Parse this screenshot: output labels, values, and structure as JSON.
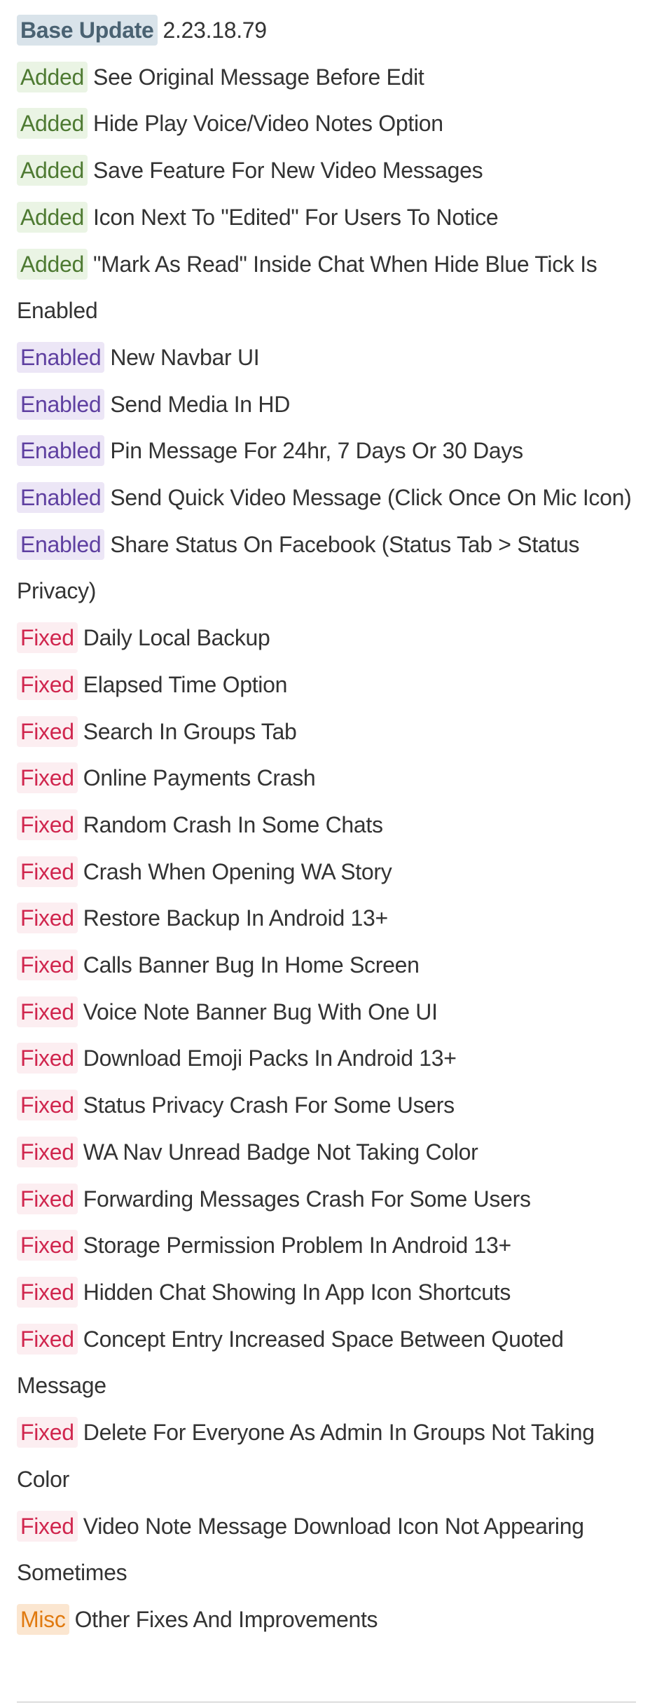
{
  "categories": {
    "base": {
      "label": "Base Update",
      "bg": "#d9e3ea",
      "fg": "#4a6272",
      "bold": true
    },
    "added": {
      "label": "Added",
      "bg": "#eaf4e4",
      "fg": "#4e7a32"
    },
    "enabled": {
      "label": "Enabled",
      "bg": "#ece6f6",
      "fg": "#5e3fa0"
    },
    "fixed": {
      "label": "Fixed",
      "bg": "#fceef1",
      "fg": "#d0264e"
    },
    "misc": {
      "label": "Misc",
      "bg": "#fbe6d0",
      "fg": "#e07a10"
    }
  },
  "items": [
    {
      "type": "base",
      "text": "2.23.18.79"
    },
    {
      "type": "added",
      "text": "See Original Message Before Edit"
    },
    {
      "type": "added",
      "text": "Hide Play Voice/Video Notes Option"
    },
    {
      "type": "added",
      "text": "Save Feature For New Video Messages"
    },
    {
      "type": "added",
      "text": "Icon Next To \"Edited\" For Users To Notice"
    },
    {
      "type": "added",
      "text": "\"Mark As Read\" Inside Chat When Hide Blue Tick Is Enabled"
    },
    {
      "type": "enabled",
      "text": "New Navbar UI"
    },
    {
      "type": "enabled",
      "text": "Send Media In HD"
    },
    {
      "type": "enabled",
      "text": "Pin Message For 24hr, 7 Days Or 30 Days"
    },
    {
      "type": "enabled",
      "text": "Send Quick Video Message (Click Once On Mic Icon)"
    },
    {
      "type": "enabled",
      "text": "Share Status On Facebook (Status Tab > Status Privacy)"
    },
    {
      "type": "fixed",
      "text": "Daily Local Backup"
    },
    {
      "type": "fixed",
      "text": "Elapsed Time Option"
    },
    {
      "type": "fixed",
      "text": "Search In Groups Tab"
    },
    {
      "type": "fixed",
      "text": "Online Payments Crash"
    },
    {
      "type": "fixed",
      "text": "Random Crash In Some Chats"
    },
    {
      "type": "fixed",
      "text": "Crash When Opening WA Story"
    },
    {
      "type": "fixed",
      "text": "Restore Backup In Android 13+"
    },
    {
      "type": "fixed",
      "text": "Calls Banner Bug In Home Screen"
    },
    {
      "type": "fixed",
      "text": "Voice Note Banner Bug With One UI"
    },
    {
      "type": "fixed",
      "text": "Download Emoji Packs In Android 13+"
    },
    {
      "type": "fixed",
      "text": "Status Privacy Crash For Some Users"
    },
    {
      "type": "fixed",
      "text": "WA Nav Unread Badge Not Taking Color"
    },
    {
      "type": "fixed",
      "text": "Forwarding Messages Crash For Some Users"
    },
    {
      "type": "fixed",
      "text": "Storage Permission Problem In Android 13+"
    },
    {
      "type": "fixed",
      "text": "Hidden Chat Showing In App Icon Shortcuts"
    },
    {
      "type": "fixed",
      "text": "Concept Entry Increased Space Between Quoted Message"
    },
    {
      "type": "fixed",
      "text": "Delete For Everyone As Admin In Groups Not Taking Color"
    },
    {
      "type": "fixed",
      "text": "Video Note Message Download Icon Not Appearing Sometimes"
    },
    {
      "type": "misc",
      "text": "Other Fixes And Improvements"
    }
  ]
}
